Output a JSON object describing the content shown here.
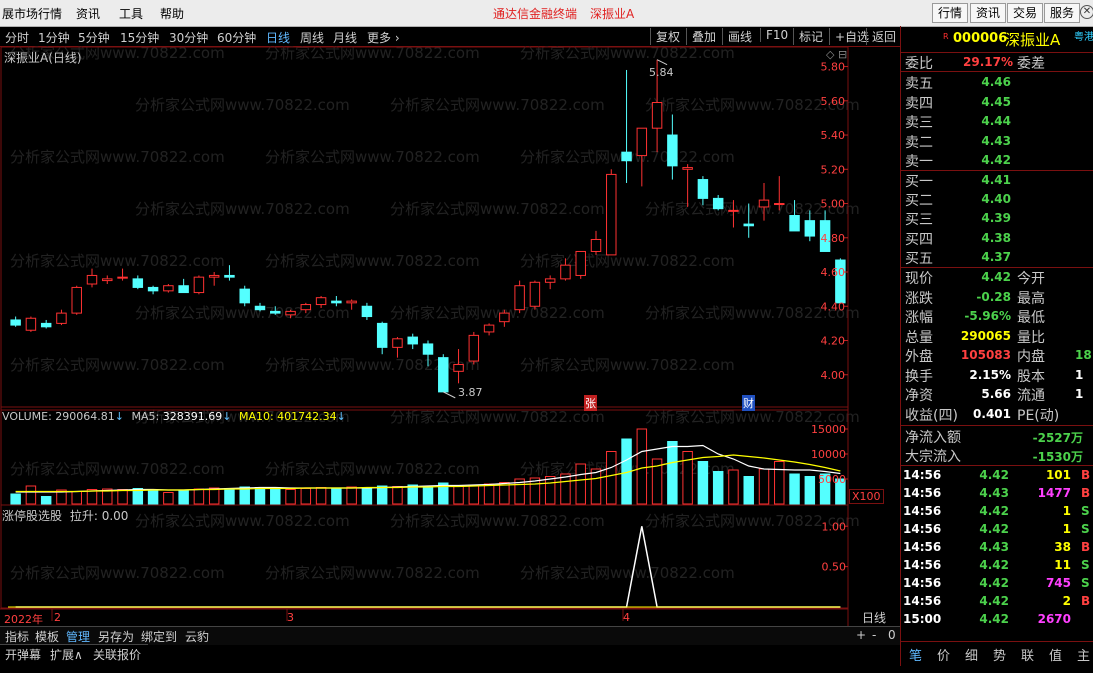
{
  "menu": {
    "items": [
      "展市场行情",
      "资讯",
      "工具",
      "帮助"
    ],
    "center_title": "通达信金融终端",
    "center_stock": "深振业A",
    "right_buttons": [
      "行情",
      "资讯",
      "交易",
      "服务"
    ]
  },
  "toolbar": {
    "periods": [
      "分时",
      "1分钟",
      "5分钟",
      "15分钟",
      "30分钟",
      "60分钟",
      "日线",
      "周线",
      "月线",
      "更多 ›"
    ],
    "active": "日线",
    "buttons": [
      "复权",
      "叠加",
      "画线",
      "F10",
      "标记",
      "+自选",
      "返回"
    ]
  },
  "chart_title": "深振业A(日线)",
  "price_axis": {
    "ticks": [
      "5.80",
      "5.60",
      "5.40",
      "5.20",
      "5.00",
      "4.80",
      "4.60",
      "4.40",
      "4.20",
      "4.00"
    ],
    "min": 3.8,
    "max": 5.92
  },
  "annotations": {
    "high": "5.84",
    "low": "3.87",
    "tag_zhang": "张",
    "tag_cai": "财"
  },
  "volume_header": {
    "vol_label": "VOLUME:",
    "vol": "290064.81",
    "ma5_label": "MA5:",
    "ma5": "328391.69",
    "ma10_label": "MA10:",
    "ma10": "401742.34"
  },
  "volume_axis": {
    "ticks": [
      "15000",
      "10000",
      "5000"
    ],
    "unit": "X100"
  },
  "indicator_header": {
    "name": "涨停股选股",
    "label": "拉升:",
    "value": "0.00"
  },
  "indicator_axis": {
    "ticks": [
      "1.00",
      "0.50"
    ]
  },
  "time_axis": {
    "labels": [
      "2022年",
      "2",
      "3",
      "4"
    ],
    "period": "日线"
  },
  "bottom": {
    "row1": [
      "指标",
      "模板",
      "管理",
      "另存为",
      "绑定到",
      "云豹"
    ],
    "active": "管理",
    "row2": [
      "开弹幕",
      "扩展∧",
      "关联报价"
    ],
    "zoom": [
      "+",
      "-",
      "0"
    ]
  },
  "watermark": "分析家公式网www.70822.com",
  "stock": {
    "code": "000006",
    "name": "深振业A",
    "badge": "R",
    "tag": "粤港"
  },
  "orderbook": {
    "ratio_label": "委比",
    "ratio": "29.17%",
    "diff_label": "委差",
    "asks": [
      {
        "label": "卖五",
        "price": "4.46"
      },
      {
        "label": "卖四",
        "price": "4.45"
      },
      {
        "label": "卖三",
        "price": "4.44"
      },
      {
        "label": "卖二",
        "price": "4.43"
      },
      {
        "label": "卖一",
        "price": "4.42"
      }
    ],
    "bids": [
      {
        "label": "买一",
        "price": "4.41"
      },
      {
        "label": "买二",
        "price": "4.40"
      },
      {
        "label": "买三",
        "price": "4.39"
      },
      {
        "label": "买四",
        "price": "4.38"
      },
      {
        "label": "买五",
        "price": "4.37"
      }
    ]
  },
  "quote": {
    "rows": [
      {
        "l1": "现价",
        "v1": "4.42",
        "c1": "grn",
        "l2": "今开"
      },
      {
        "l1": "涨跌",
        "v1": "-0.28",
        "c1": "grn",
        "l2": "最高"
      },
      {
        "l1": "涨幅",
        "v1": "-5.96%",
        "c1": "grn",
        "l2": "最低"
      },
      {
        "l1": "总量",
        "v1": "290065",
        "c1": "yel",
        "l2": "量比"
      },
      {
        "l1": "外盘",
        "v1": "105083",
        "c1": "red",
        "l2": "内盘",
        "v2": "18"
      },
      {
        "l1": "换手",
        "v1": "2.15%",
        "c1": "wht",
        "l2": "股本",
        "v2": "1"
      },
      {
        "l1": "净资",
        "v1": "5.66",
        "c1": "wht",
        "l2": "流通",
        "v2": "1"
      },
      {
        "l1": "收益(四)",
        "v1": "0.401",
        "c1": "wht",
        "l2": "PE(动)"
      }
    ]
  },
  "flow": [
    {
      "label": "净流入额",
      "value": "-2527万"
    },
    {
      "label": "大宗流入",
      "value": "-1530万"
    }
  ],
  "ticks": [
    {
      "t": "14:56",
      "p": "4.42",
      "v": "101",
      "vc": "yel",
      "s": "B"
    },
    {
      "t": "14:56",
      "p": "4.43",
      "v": "1477",
      "vc": "mag",
      "s": "B"
    },
    {
      "t": "14:56",
      "p": "4.42",
      "v": "1",
      "vc": "yel",
      "s": "S"
    },
    {
      "t": "14:56",
      "p": "4.42",
      "v": "1",
      "vc": "yel",
      "s": "S"
    },
    {
      "t": "14:56",
      "p": "4.43",
      "v": "38",
      "vc": "yel",
      "s": "B"
    },
    {
      "t": "14:56",
      "p": "4.42",
      "v": "11",
      "vc": "yel",
      "s": "S"
    },
    {
      "t": "14:56",
      "p": "4.42",
      "v": "745",
      "vc": "mag",
      "s": "S"
    },
    {
      "t": "14:56",
      "p": "4.42",
      "v": "2",
      "vc": "yel",
      "s": "B"
    },
    {
      "t": "15:00",
      "p": "4.42",
      "v": "2670",
      "vc": "mag",
      "s": ""
    }
  ],
  "right_tabs": [
    "笔",
    "价",
    "细",
    "势",
    "联",
    "值",
    "主"
  ],
  "chart_data": {
    "type": "candlestick",
    "title": "深振业A(日线)",
    "ylim": [
      3.8,
      5.92
    ],
    "volume_ylim": [
      0,
      16000
    ],
    "high_marker": 5.84,
    "low_marker": 3.87,
    "candles": [
      [
        4.32,
        4.34,
        4.28,
        4.29
      ],
      [
        4.26,
        4.34,
        4.25,
        4.33
      ],
      [
        4.3,
        4.32,
        4.27,
        4.28
      ],
      [
        4.3,
        4.38,
        4.29,
        4.36
      ],
      [
        4.36,
        4.52,
        4.35,
        4.51
      ],
      [
        4.53,
        4.62,
        4.51,
        4.58
      ],
      [
        4.55,
        4.58,
        4.53,
        4.56
      ],
      [
        4.57,
        4.62,
        4.55,
        4.57
      ],
      [
        4.56,
        4.58,
        4.5,
        4.51
      ],
      [
        4.51,
        4.52,
        4.47,
        4.49
      ],
      [
        4.49,
        4.53,
        4.48,
        4.52
      ],
      [
        4.52,
        4.56,
        4.48,
        4.48
      ],
      [
        4.48,
        4.58,
        4.47,
        4.57
      ],
      [
        4.57,
        4.6,
        4.52,
        4.58
      ],
      [
        4.58,
        4.64,
        4.55,
        4.57
      ],
      [
        4.5,
        4.52,
        4.4,
        4.42
      ],
      [
        4.4,
        4.42,
        4.37,
        4.38
      ],
      [
        4.37,
        4.4,
        4.35,
        4.36
      ],
      [
        4.35,
        4.38,
        4.33,
        4.37
      ],
      [
        4.38,
        4.42,
        4.36,
        4.41
      ],
      [
        4.41,
        4.46,
        4.39,
        4.45
      ],
      [
        4.43,
        4.46,
        4.4,
        4.42
      ],
      [
        4.42,
        4.44,
        4.38,
        4.43
      ],
      [
        4.4,
        4.42,
        4.32,
        4.34
      ],
      [
        4.3,
        4.31,
        4.12,
        4.16
      ],
      [
        4.16,
        4.22,
        4.1,
        4.21
      ],
      [
        4.22,
        4.24,
        4.15,
        4.18
      ],
      [
        4.18,
        4.2,
        4.05,
        4.12
      ],
      [
        4.1,
        4.12,
        3.92,
        3.9
      ],
      [
        4.02,
        4.15,
        3.95,
        4.06
      ],
      [
        4.08,
        4.25,
        4.06,
        4.23
      ],
      [
        4.25,
        4.3,
        4.23,
        4.29
      ],
      [
        4.31,
        4.38,
        4.28,
        4.36
      ],
      [
        4.38,
        4.55,
        4.36,
        4.52
      ],
      [
        4.4,
        4.55,
        4.38,
        4.54
      ],
      [
        4.54,
        4.58,
        4.5,
        4.56
      ],
      [
        4.56,
        4.68,
        4.55,
        4.64
      ],
      [
        4.58,
        4.72,
        4.56,
        4.72
      ],
      [
        4.72,
        4.84,
        4.7,
        4.79
      ],
      [
        4.7,
        5.2,
        4.7,
        5.17
      ],
      [
        5.3,
        5.78,
        5.12,
        5.25
      ],
      [
        5.28,
        5.44,
        5.1,
        5.44
      ],
      [
        5.44,
        5.84,
        5.3,
        5.59
      ],
      [
        5.4,
        5.52,
        5.14,
        5.22
      ],
      [
        5.2,
        5.23,
        4.98,
        5.21
      ],
      [
        5.14,
        5.16,
        4.99,
        5.03
      ],
      [
        5.03,
        5.05,
        4.96,
        4.97
      ],
      [
        4.96,
        5.02,
        4.86,
        4.96
      ],
      [
        4.88,
        5.0,
        4.8,
        4.87
      ],
      [
        4.98,
        5.12,
        4.9,
        5.02
      ],
      [
        5.0,
        5.16,
        4.96,
        5.0
      ],
      [
        4.93,
        5.02,
        4.84,
        4.84
      ],
      [
        4.9,
        4.96,
        4.78,
        4.81
      ],
      [
        4.9,
        4.96,
        4.72,
        4.72
      ],
      [
        4.67,
        4.68,
        4.42,
        4.42
      ]
    ],
    "volume": [
      2000,
      3600,
      1500,
      2800,
      2500,
      2900,
      3000,
      2900,
      3100,
      2800,
      2300,
      2600,
      3000,
      3200,
      3100,
      3400,
      3300,
      3000,
      2900,
      3100,
      3300,
      3200,
      3400,
      3300,
      3600,
      3500,
      3800,
      3400,
      4200,
      3600,
      3800,
      4000,
      4300,
      5000,
      5200,
      5500,
      6000,
      8000,
      7000,
      10500,
      13000,
      15000,
      9000,
      12500,
      10500,
      8500,
      6500,
      6800,
      5500,
      7000,
      8500,
      6000,
      5500,
      6000,
      5000
    ],
    "ma5": [
      2400,
      2400,
      2400,
      2400,
      2500,
      2600,
      2700,
      2800,
      2900,
      2900,
      2800,
      2800,
      2900,
      3000,
      3100,
      3200,
      3300,
      3300,
      3200,
      3200,
      3200,
      3200,
      3200,
      3200,
      3300,
      3400,
      3500,
      3600,
      3700,
      3700,
      3800,
      3900,
      4100,
      4300,
      4600,
      5000,
      5400,
      5900,
      6300,
      7300,
      8800,
      10500,
      11000,
      11500,
      11500,
      11700,
      10000,
      9000,
      7600,
      7000,
      6900,
      6800,
      6800,
      6500,
      6100
    ],
    "ma10": [
      2500,
      2500,
      2500,
      2500,
      2500,
      2600,
      2600,
      2700,
      2700,
      2800,
      2800,
      2800,
      2900,
      2900,
      3000,
      3000,
      3100,
      3100,
      3100,
      3200,
      3200,
      3200,
      3200,
      3300,
      3300,
      3300,
      3400,
      3400,
      3500,
      3500,
      3600,
      3700,
      3800,
      3900,
      4000,
      4200,
      4500,
      4800,
      5100,
      5700,
      6300,
      7200,
      7600,
      8300,
      8800,
      9300,
      9500,
      9800,
      9500,
      9200,
      8800,
      8400,
      7900,
      7300,
      6600
    ],
    "indicator": [
      0,
      0,
      0,
      0,
      0,
      0,
      0,
      0,
      0,
      0,
      0,
      0,
      0,
      0,
      0,
      0,
      0,
      0,
      0,
      0,
      0,
      0,
      0,
      0,
      0,
      0,
      0,
      0,
      0,
      0,
      0,
      0,
      0,
      0,
      0,
      0,
      0,
      0,
      0,
      0,
      0,
      1,
      0,
      0,
      0,
      0,
      0,
      0,
      0,
      0,
      0,
      0,
      0,
      0,
      0
    ]
  }
}
